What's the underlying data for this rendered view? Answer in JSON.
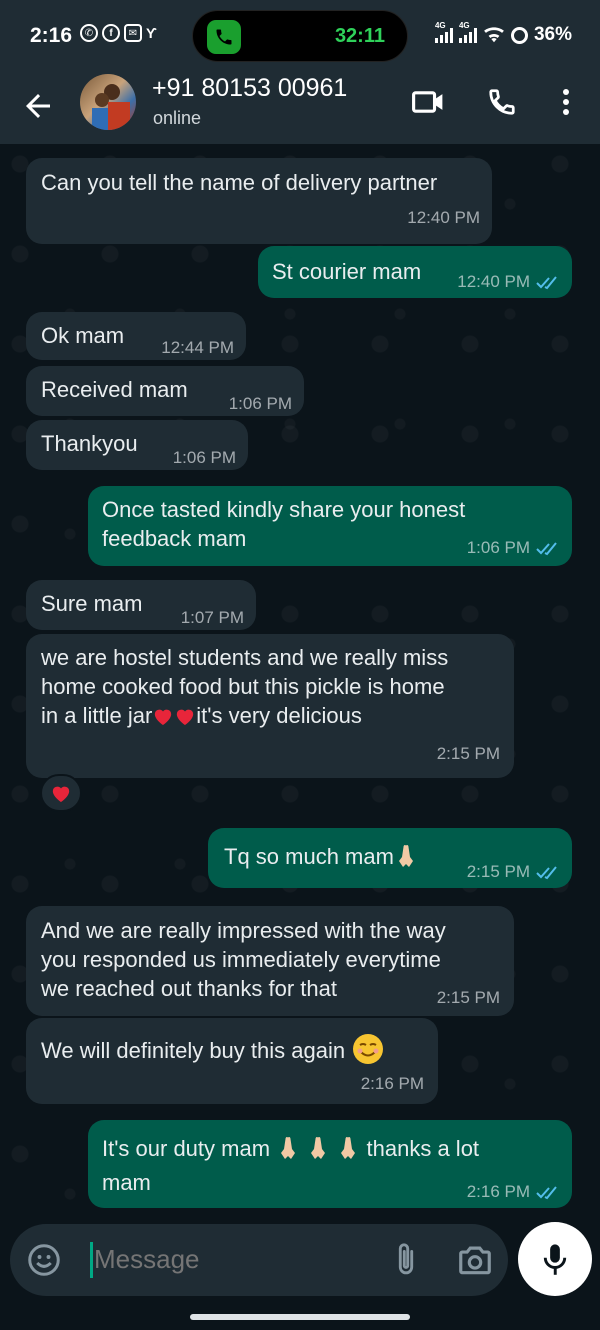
{
  "status_bar": {
    "time": "2:16",
    "call_timer": "32:11",
    "network_1": "4G",
    "network_2": "4G",
    "battery": "36%",
    "call_color": "#1a9f2e"
  },
  "header": {
    "contact_name": "+91 80153 00961",
    "contact_status": "online"
  },
  "messages": [
    {
      "dir": "in",
      "text": "Can you tell the name of delivery partner",
      "time": "12:40 PM"
    },
    {
      "dir": "out",
      "text": "St courier mam",
      "time": "12:40 PM"
    },
    {
      "dir": "in",
      "text": "Ok mam",
      "time": "12:44 PM"
    },
    {
      "dir": "in",
      "text": "Received mam",
      "time": "1:06 PM"
    },
    {
      "dir": "in",
      "text": "Thankyou",
      "time": "1:06 PM"
    },
    {
      "dir": "out",
      "text": "Once tasted kindly share your honest\nfeedback mam",
      "time": "1:06 PM"
    },
    {
      "dir": "in",
      "text": "Sure mam",
      "time": "1:07 PM"
    },
    {
      "dir": "in",
      "text_a": "we are hostel students and we really miss\nhome cooked food but this pickle is home\nin a little jar",
      "text_b": "it's very delicious",
      "time": "2:15 PM"
    },
    {
      "dir": "out",
      "text": "Tq so much mam",
      "time": "2:15 PM"
    },
    {
      "dir": "in",
      "text": "And we are really impressed with the way\nyou responded us immediately everytime\nwe reached out thanks for that",
      "time": "2:15 PM"
    },
    {
      "dir": "in",
      "text": "We will definitely buy this again",
      "time": "2:16 PM"
    },
    {
      "dir": "out",
      "text_a": "It's our duty mam",
      "text_b": "thanks a lot",
      "text_c": "mam",
      "time": "2:16 PM"
    }
  ],
  "input": {
    "placeholder": "Message"
  },
  "colors": {
    "incoming_bubble": "#1f2c34",
    "outgoing_bubble": "#005c4b",
    "read_ticks": "#53bdeb",
    "heart": "#e8253a"
  },
  "icons": [
    "back-arrow-icon",
    "video-call-icon",
    "voice-call-icon",
    "more-options-icon",
    "emoji-icon",
    "attach-icon",
    "camera-icon",
    "mic-icon",
    "read-receipt-icon",
    "heart-emoji",
    "folded-hands-emoji",
    "smiling-face-emoji"
  ]
}
